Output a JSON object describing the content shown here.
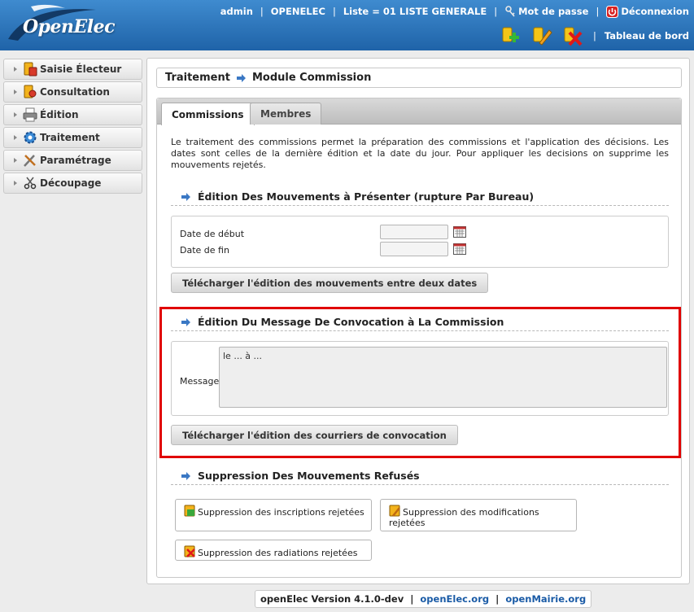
{
  "header": {
    "logo_text": "OpenElec",
    "user": "admin",
    "collectivite": "OPENELEC",
    "liste": "Liste = 01 LISTE GENERALE",
    "password_label": "Mot de passe",
    "logout_label": "Déconnexion",
    "dashboard_label": "Tableau de bord"
  },
  "sidebar": {
    "items": [
      {
        "label": "Saisie Électeur",
        "icon": "voter-entry-icon"
      },
      {
        "label": "Consultation",
        "icon": "consultation-icon"
      },
      {
        "label": "Édition",
        "icon": "printer-icon"
      },
      {
        "label": "Traitement",
        "icon": "gear-icon"
      },
      {
        "label": "Paramétrage",
        "icon": "tools-icon"
      },
      {
        "label": "Découpage",
        "icon": "scissors-icon"
      }
    ]
  },
  "page": {
    "breadcrumb_parent": "Traitement",
    "breadcrumb_current": "Module Commission"
  },
  "tabs": [
    {
      "label": "Commissions",
      "active": true
    },
    {
      "label": "Membres",
      "active": false
    }
  ],
  "intro": "Le traitement des commissions permet la préparation des commissions et l'application des décisions. Les dates sont celles de la dernière édition et la date du jour. Pour appliquer les decisions on supprime les mouvements rejetés.",
  "section_mouvements": {
    "title": "Édition Des Mouvements à Présenter (rupture Par Bureau)",
    "date_debut_label": "Date de début",
    "date_debut_value": "",
    "date_fin_label": "Date de fin",
    "date_fin_value": "",
    "button": "Télécharger l'édition des mouvements entre deux dates"
  },
  "section_convocation": {
    "title": "Édition Du Message De Convocation à La Commission",
    "message_label": "Message",
    "message_value": "le ... à ...",
    "button": "Télécharger l'édition des courriers de convocation"
  },
  "section_suppression": {
    "title": "Suppression Des Mouvements Refusés",
    "btn_inscriptions": "Suppression des inscriptions rejetées",
    "btn_modifications": "Suppression des modifications rejetées",
    "btn_radiations": "Suppression des radiations rejetées"
  },
  "footer": {
    "version": "openElec Version 4.1.0-dev",
    "link1": "openElec.org",
    "link2": "openMairie.org"
  },
  "colors": {
    "header_blue": "#1f63a8",
    "highlight_red": "#e00000",
    "link_blue": "#1a5ba6"
  }
}
